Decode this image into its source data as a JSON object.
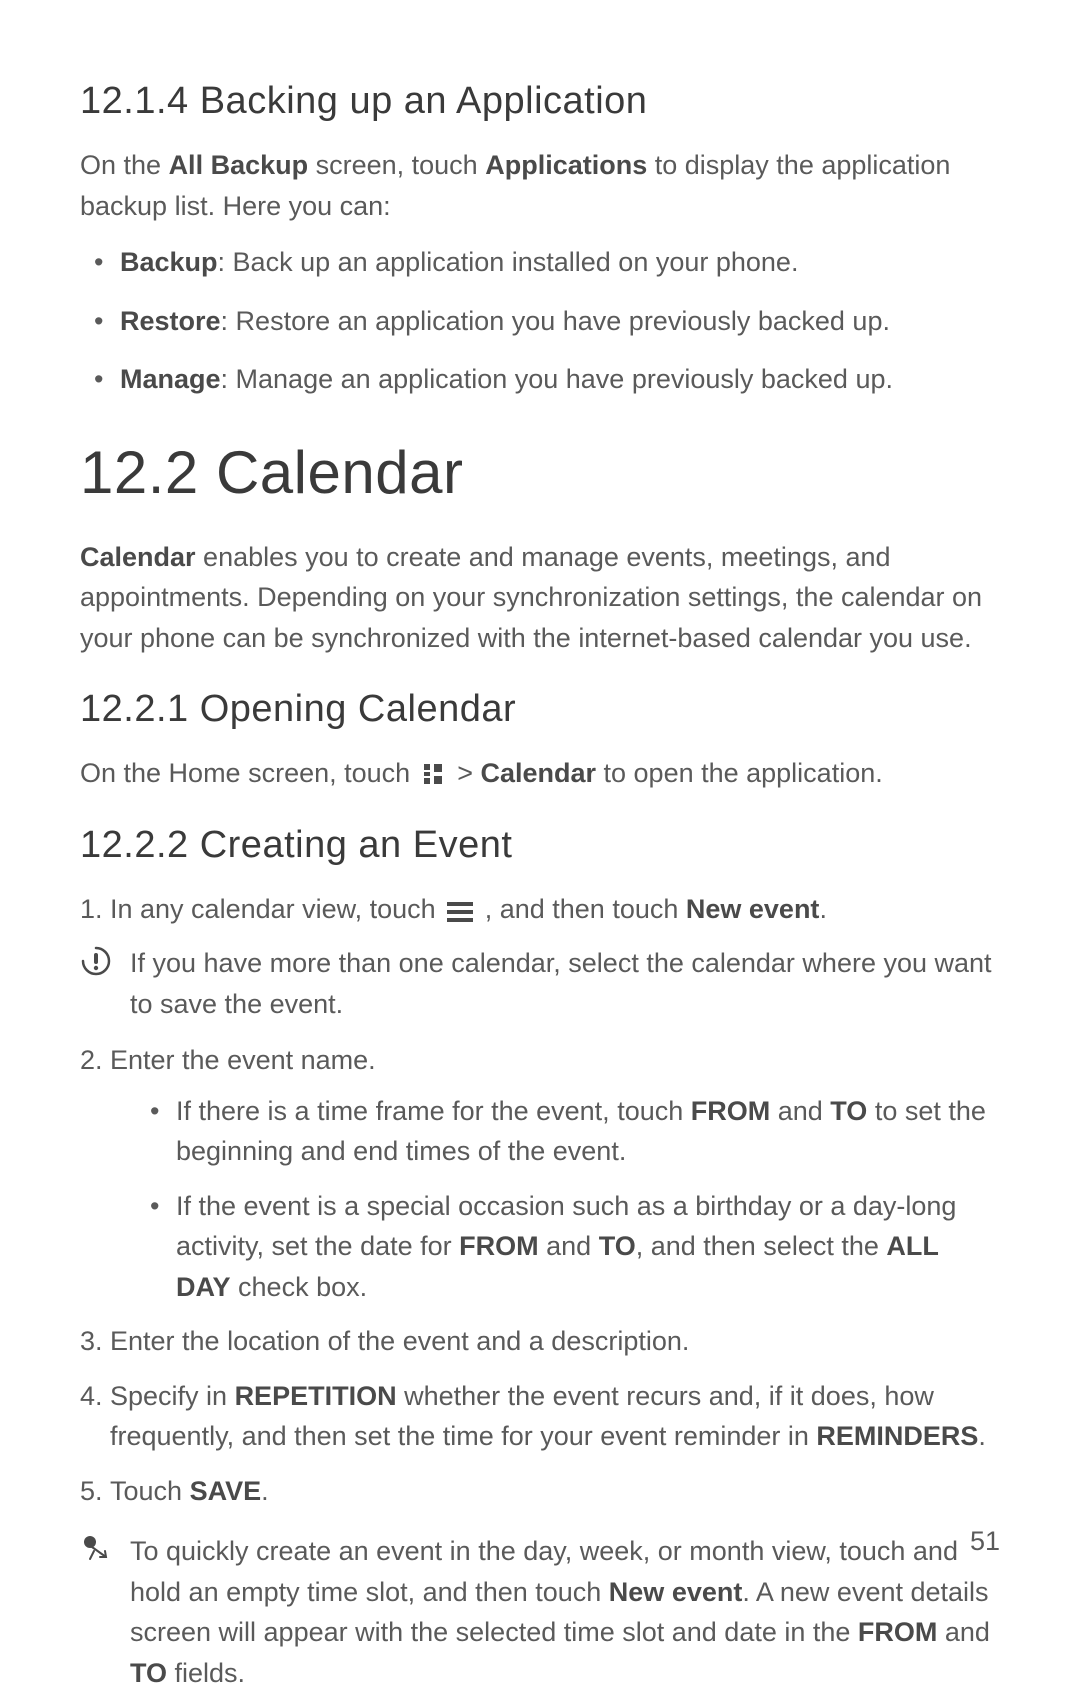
{
  "section_12_1_4": {
    "heading": "12.1.4  Backing up an Application",
    "intro_prefix": " On the ",
    "intro_bold1": "All Backup",
    "intro_mid": " screen, touch ",
    "intro_bold2": "Applications",
    "intro_suffix": " to display the application backup list. Here you can:",
    "items": [
      {
        "label": "Backup",
        "desc": ": Back up an application installed on your phone."
      },
      {
        "label": "Restore",
        "desc": ": Restore an application you have previously backed up."
      },
      {
        "label": "Manage",
        "desc": ": Manage an application you have previously backed up."
      }
    ]
  },
  "section_12_2": {
    "heading": "12.2  Calendar",
    "intro_bold": "Calendar",
    "intro_rest": " enables you to create and manage events, meetings, and appointments. Depending on your synchronization settings, the calendar on your phone can be synchronized with the internet-based calendar you use."
  },
  "section_12_2_1": {
    "heading": "12.2.1  Opening Calendar",
    "line_prefix": "On the Home screen, touch ",
    "line_mid": "  > ",
    "line_bold": "Calendar",
    "line_suffix": " to open the application."
  },
  "section_12_2_2": {
    "heading": "12.2.2  Creating an Event",
    "step1_num": "1.",
    "step1_prefix": "In any calendar view, touch ",
    "step1_mid": " , and then touch ",
    "step1_bold": "New event",
    "step1_suffix": ".",
    "note1": "If you have more than one calendar, select the calendar where you want to save the event.",
    "step2_num": "2.",
    "step2_text": "Enter the event name.",
    "step2_sub1_a": "If there is a time frame for the event, touch ",
    "step2_sub1_from": "FROM",
    "step2_sub1_b": " and ",
    "step2_sub1_to": "TO",
    "step2_sub1_c": " to set the beginning and end times of the event.",
    "step2_sub2_a": "If the event is a special occasion such as a birthday or a day-long activity, set the date for ",
    "step2_sub2_from": "FROM",
    "step2_sub2_b": " and ",
    "step2_sub2_to": "TO",
    "step2_sub2_c": ", and then select the ",
    "step2_sub2_allday": "ALL DAY",
    "step2_sub2_d": " check box.",
    "step3_num": "3.",
    "step3_text": "Enter the location of the event and a description.",
    "step4_num": "4.",
    "step4_a": "Specify in ",
    "step4_rep": "REPETITION",
    "step4_b": " whether the event recurs and, if it does, how frequently, and then set the time for your event reminder in ",
    "step4_rem": "REMINDERS",
    "step4_c": ".",
    "step5_num": "5.",
    "step5_a": "Touch ",
    "step5_save": "SAVE",
    "step5_b": ".",
    "tip_a": "To quickly create an event in the day, week, or month view, touch and hold an empty time slot, and then touch ",
    "tip_newevent": "New event",
    "tip_b": ". A new event details screen will appear with the selected time slot and date in the ",
    "tip_from": "FROM",
    "tip_c": " and ",
    "tip_to": "TO",
    "tip_d": " fields."
  },
  "page_number": "51",
  "icons": {
    "apps": "apps-grid-icon",
    "menu": "menu-three-lines-icon",
    "alert": "alert-circle-icon",
    "tip": "tip-pointer-icon"
  }
}
